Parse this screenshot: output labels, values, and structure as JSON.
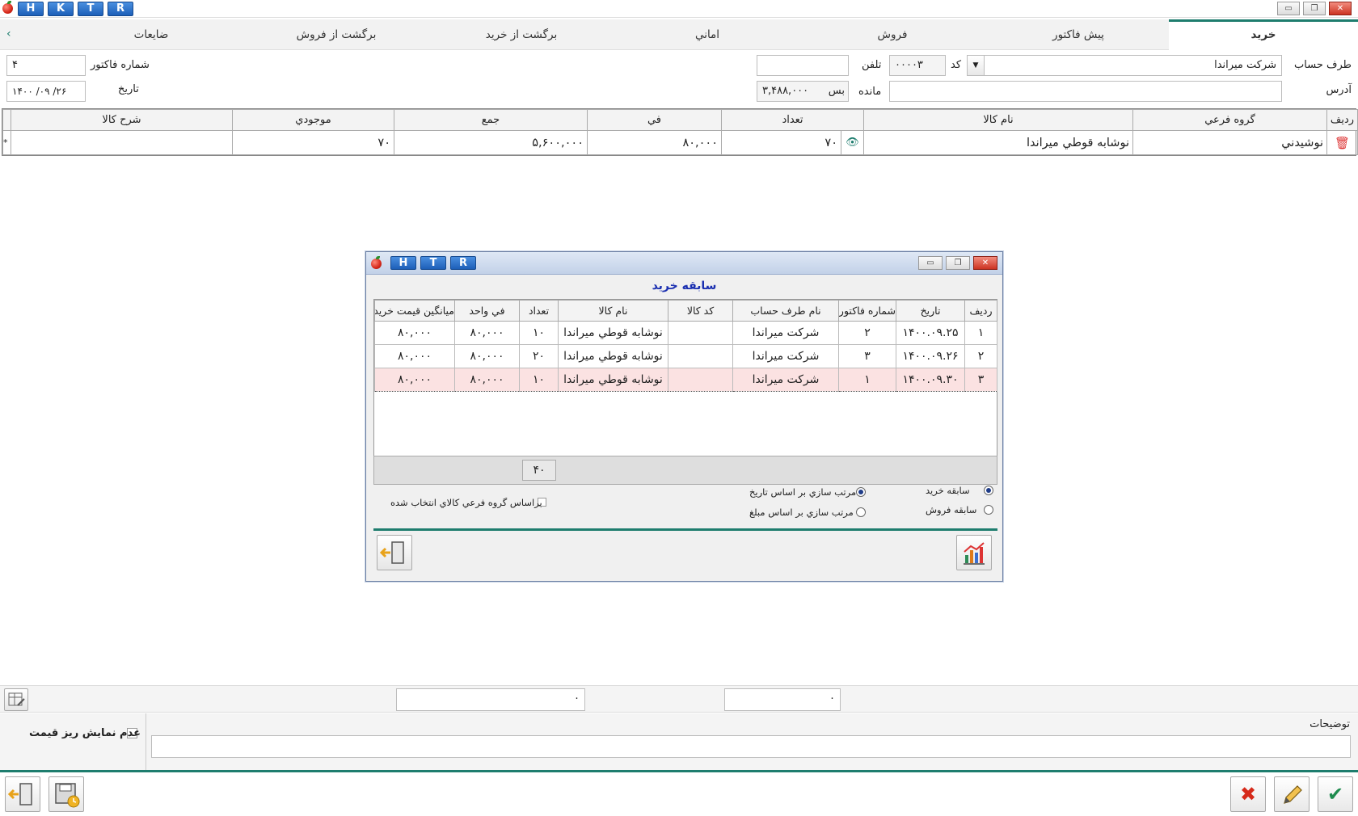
{
  "titlebar": {
    "hotkeys": [
      "H",
      "K",
      "T",
      "R"
    ],
    "window_buttons": [
      "▭",
      "❐",
      "✕"
    ]
  },
  "tabs": [
    "خرید",
    "پیش فاکتور",
    "فروش",
    "اماني",
    "برگشت از خرید",
    "برگشت از فروش",
    "ضایعات"
  ],
  "tabs_arrow": "‹",
  "header": {
    "account_label": "طرف حساب",
    "account_value": "شرکت ميراندا",
    "code_label": "کد",
    "code_value": "۰۰۰۰۳",
    "phone_label": "تلفن",
    "phone_value": "",
    "address_label": "آدرس",
    "address_value": "",
    "balance_label": "مانده",
    "balance_value": "۳,۴۸۸,۰۰۰",
    "balance_suffix": "بس",
    "invoice_label": "شماره فاکتور",
    "invoice_value": "۴",
    "date_label": "تاریخ",
    "date_value": "۱۴۰۰ /۰۹ /۲۶"
  },
  "main_grid": {
    "headers": [
      "رديف",
      "گروه فرعي",
      "نام کالا",
      "تعداد",
      "في",
      "جمع",
      "موجودي",
      "شرح کالا"
    ],
    "rows": [
      {
        "group": "نوشيدني",
        "product": "نوشابه قوطي ميراندا",
        "qty": "۷۰",
        "price": "۸۰,۰۰۰",
        "total": "۵,۶۰۰,۰۰۰",
        "stock": "۷۰",
        "desc": ""
      }
    ],
    "new_row_marker": "*"
  },
  "modal": {
    "hotkeys": [
      "H",
      "T",
      "R"
    ],
    "title": "سابقه خرید",
    "headers": [
      "رديف",
      "تاريخ",
      "شماره فاکتور",
      "نام طرف حساب",
      "کد کالا",
      "نام کالا",
      "تعداد",
      "في واحد",
      "ميانگين قيمت خريد"
    ],
    "rows": [
      {
        "n": "۱",
        "date": "۱۴۰۰.۰۹.۲۵",
        "invoice": "۲",
        "account": "شرکت ميراندا",
        "code": "",
        "product": "نوشابه قوطي ميراندا",
        "qty": "۱۰",
        "unit": "۸۰,۰۰۰",
        "avg": "۸۰,۰۰۰"
      },
      {
        "n": "۲",
        "date": "۱۴۰۰.۰۹.۲۶",
        "invoice": "۳",
        "account": "شرکت ميراندا",
        "code": "",
        "product": "نوشابه قوطي ميراندا",
        "qty": "۲۰",
        "unit": "۸۰,۰۰۰",
        "avg": "۸۰,۰۰۰"
      },
      {
        "n": "۳",
        "date": "۱۴۰۰.۰۹.۳۰",
        "invoice": "۱",
        "account": "شرکت ميراندا",
        "code": "",
        "product": "نوشابه قوطي ميراندا",
        "qty": "۱۰",
        "unit": "۸۰,۰۰۰",
        "avg": "۸۰,۰۰۰"
      }
    ],
    "footer_total": "۴۰",
    "radio_purchase": "سابقه خرید",
    "radio_sales": "سابقه فروش",
    "sort_date": "مرتب سازي بر اساس تاريخ",
    "sort_amount": "مرتب سازي بر اساس مبلغ",
    "filter_group": "براساس گروه فرعي کالاي انتخاب شده"
  },
  "summary": {
    "left_value": "۰",
    "right_value": "۰"
  },
  "notes": {
    "label": "توضیحات",
    "value": "",
    "hide_price_label": "عدم نمايش ريز قيمت"
  },
  "colors": {
    "accent": "#1e7d6e",
    "selected_row": "#fbe2e2",
    "modal_title": "#1a2fb0"
  }
}
